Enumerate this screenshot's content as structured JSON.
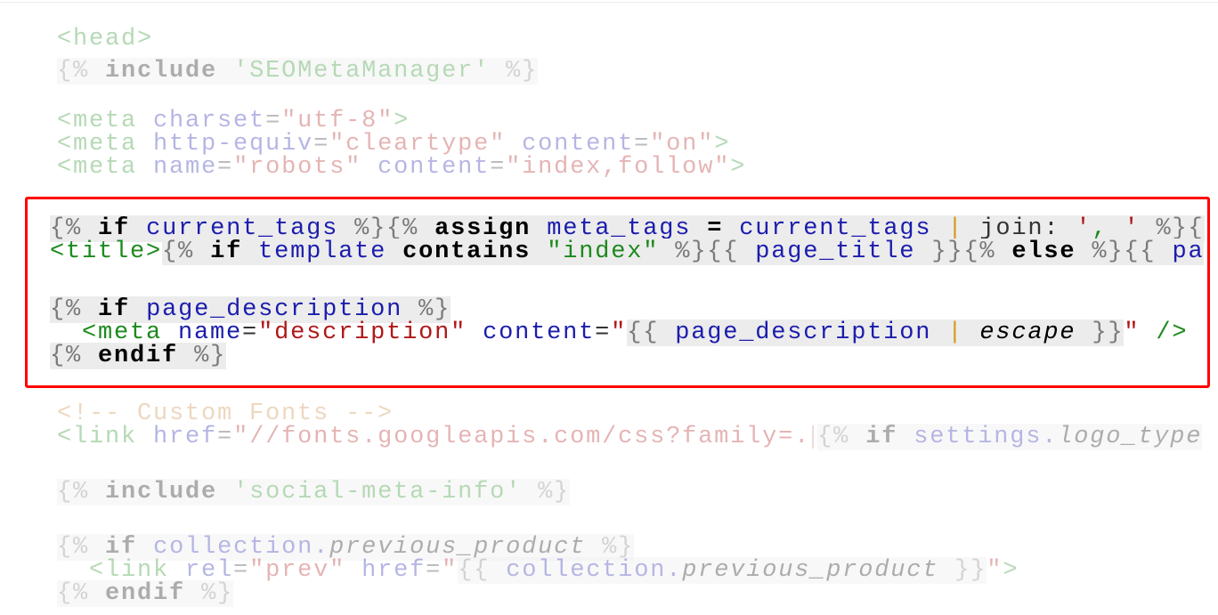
{
  "editor": {
    "highlight_color": "#ff0000",
    "lines_before": {
      "head_open": "<head>",
      "include_seo": {
        "delim_open": "{%",
        "keyword": "include",
        "name": "'SEOMetaManager'",
        "delim_close": "%}"
      },
      "meta_charset": {
        "tag": "<meta",
        "attr": "charset",
        "value": "\"utf-8\"",
        "close": ">"
      },
      "meta_cleartype": {
        "tag": "<meta",
        "attr1": "http-equiv",
        "value1": "\"cleartype\"",
        "attr2": "content",
        "value2": "\"on\"",
        "close": ">"
      },
      "meta_robots": {
        "tag": "<meta",
        "attr1": "name",
        "value1": "\"robots\"",
        "attr2": "content",
        "value2": "\"index,follow\"",
        "close": ">"
      }
    },
    "highlighted": {
      "line1": {
        "d1": "{%",
        "kw1": "if",
        "var1": "current_tags",
        "d2": "%}",
        "d3": "{%",
        "kw2": "assign",
        "var2": "meta_tags",
        "eq": "=",
        "var3": "current_tags",
        "pipe": "|",
        "filter": "join:",
        "str_q1": "'",
        "str_comma": ",",
        "str_q2": "'",
        "d4": "%}",
        "tail": "{"
      },
      "line2": {
        "tag": "<title>",
        "d1": "{%",
        "kw1": "if",
        "var1": "template",
        "kw2": "contains",
        "str": "\"index\"",
        "d2": "%}",
        "o1": "{{",
        "var2": "page_title",
        "c1": "}}",
        "d3": "{%",
        "kw3": "else",
        "d4": "%}",
        "o2": "{{",
        "var3": "pa"
      },
      "line3": {
        "d1": "{%",
        "kw": "if",
        "var": "page_description",
        "d2": "%}"
      },
      "line4": {
        "tag": "<meta",
        "attr1": "name",
        "value1": "\"description\"",
        "attr2": "content",
        "q_open": "\"",
        "o1": "{{",
        "var": "page_description",
        "pipe": "|",
        "filter": "escape",
        "c1": "}}",
        "q_close": "\"",
        "close": "/>"
      },
      "line5": {
        "d1": "{%",
        "kw": "endif",
        "d2": "%}"
      }
    },
    "lines_after": {
      "comment": "<!-- Custom Fonts -->",
      "link_fonts": {
        "tag": "<link",
        "attr": "href",
        "value": "\"//fonts.googleapis.com/css?family=.",
        "d1": "{%",
        "kw": "if",
        "var": "settings.",
        "var_it": "logo_type"
      },
      "include_social": {
        "delim_open": "{%",
        "keyword": "include",
        "name": "'social-meta-info'",
        "delim_close": "%}"
      },
      "if_prev": {
        "d1": "{%",
        "kw": "if",
        "var": "collection.",
        "var_it": "previous_product",
        "d2": "%}"
      },
      "link_prev": {
        "tag": "<link",
        "attr1": "rel",
        "value1": "\"prev\"",
        "attr2": "href",
        "q_open": "\"",
        "o1": "{{",
        "var": "collection.",
        "var_it": "previous_product",
        "c1": "}}",
        "q_close": "\"",
        "close": ">"
      },
      "endif": {
        "d1": "{%",
        "kw": "endif",
        "d2": "%}"
      }
    }
  }
}
